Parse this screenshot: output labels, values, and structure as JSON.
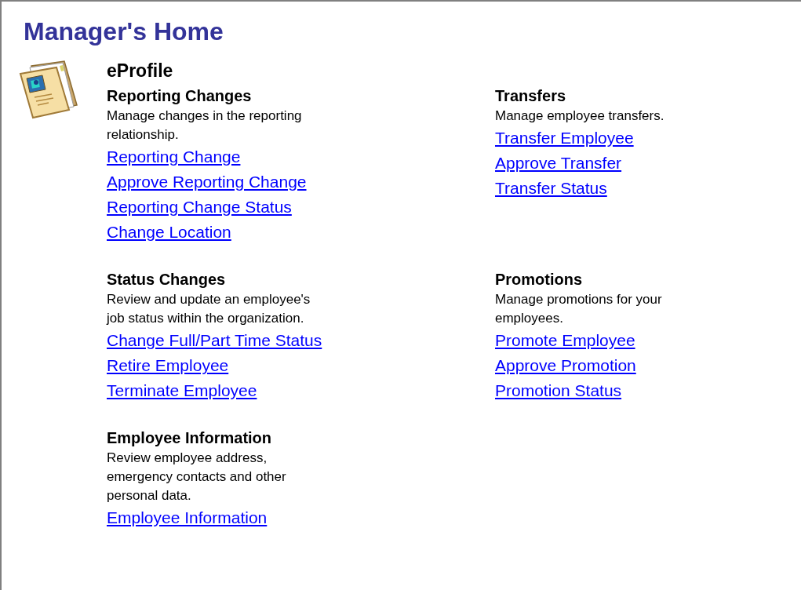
{
  "page_title": "Manager's Home",
  "module": {
    "title": "eProfile"
  },
  "sections": [
    {
      "title": "Reporting Changes",
      "description": [
        "Manage changes in the reporting",
        "relationship."
      ],
      "links": [
        "Reporting Change",
        "Approve Reporting Change",
        "Reporting Change Status",
        "Change Location"
      ]
    },
    {
      "title": "Transfers",
      "description": [
        "Manage employee transfers."
      ],
      "links": [
        "Transfer Employee",
        "Approve Transfer",
        "Transfer Status"
      ]
    },
    {
      "title": "Status Changes",
      "description": [
        "Review and update an employee's",
        "job status within the organization."
      ],
      "links": [
        "Change Full/Part Time Status",
        "Retire Employee",
        "Terminate Employee"
      ]
    },
    {
      "title": "Promotions",
      "description": [
        "Manage promotions for your",
        "employees."
      ],
      "links": [
        "Promote Employee",
        "Approve Promotion",
        "Promotion Status"
      ]
    },
    {
      "title": "Employee Information",
      "description": [
        "Review employee address,",
        "emergency contacts and other",
        "personal data."
      ],
      "links": [
        "Employee Information"
      ]
    }
  ]
}
